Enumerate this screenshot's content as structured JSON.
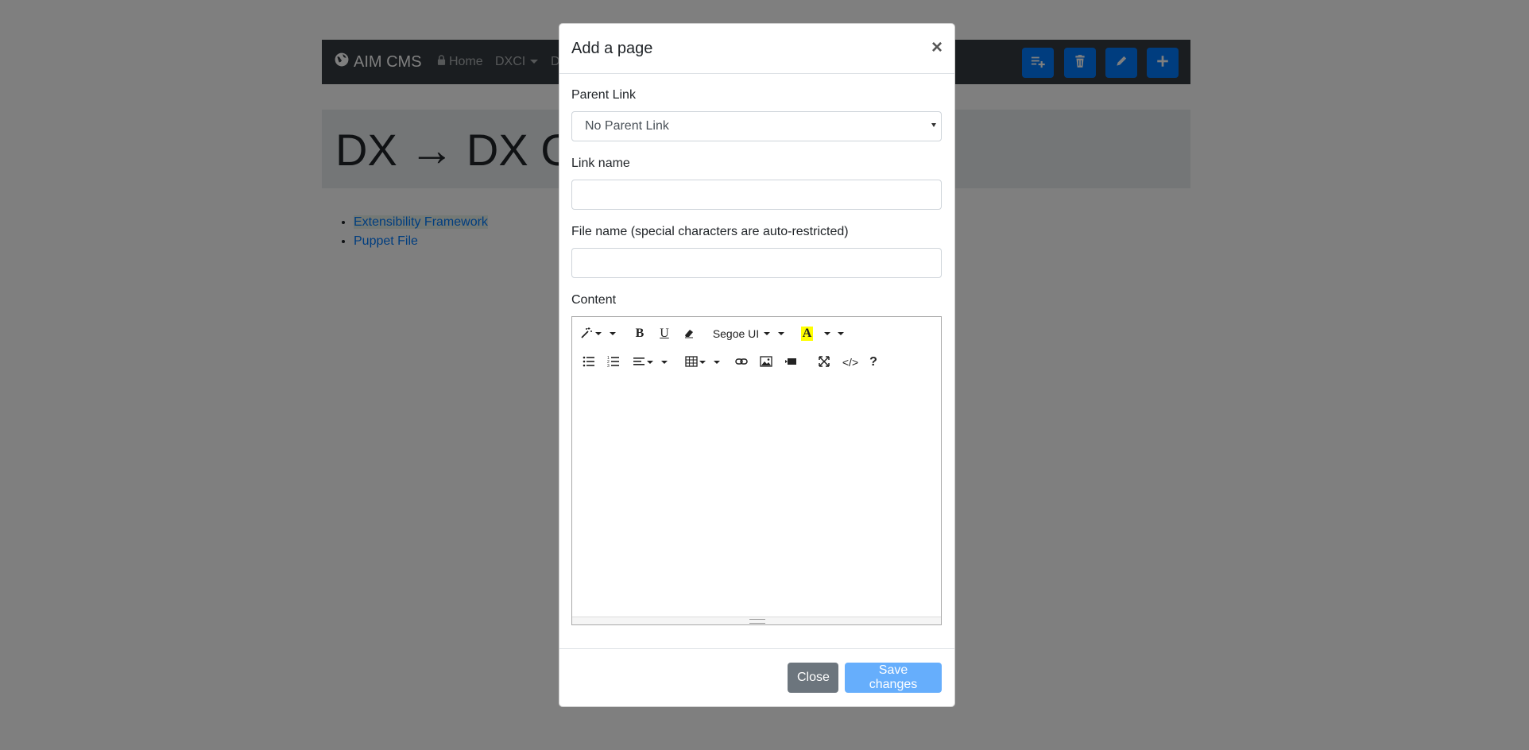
{
  "navbar": {
    "brand": "AIM CMS",
    "home": "Home",
    "dxci": "DXCI",
    "partial_item": "D"
  },
  "jumbotron": {
    "title": "DX → DX G"
  },
  "links": [
    "Extensibility Framework",
    "Puppet File"
  ],
  "modal": {
    "title": "Add a page",
    "close_glyph": "×",
    "parent_link": {
      "label": "Parent Link",
      "value": "No Parent Link"
    },
    "link_name": {
      "label": "Link name",
      "value": ""
    },
    "file_name": {
      "label": "File name (special characters are auto-restricted)",
      "value": ""
    },
    "content": {
      "label": "Content",
      "font_name": "Segoe UI",
      "code_view": "</>",
      "help": "?"
    },
    "buttons": {
      "close": "Close",
      "save": "Save changes"
    }
  },
  "colors": {
    "primary": "#007bff",
    "navbar": "#343a40",
    "secondary": "#6c757d",
    "save_disabled": "#66aefc",
    "highlight": "#ffff00"
  }
}
